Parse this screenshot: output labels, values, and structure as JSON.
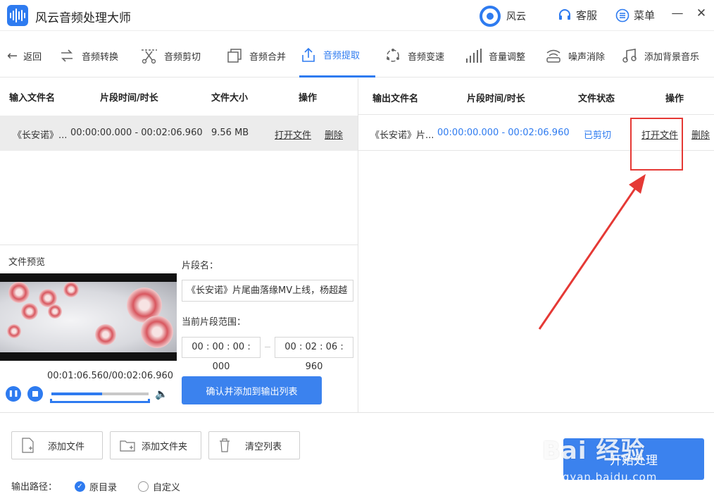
{
  "app": {
    "title": "风云音频处理大师",
    "brand": "风云",
    "service": "客服",
    "menu": "菜单"
  },
  "window": {
    "minimize": "—",
    "close": "✕"
  },
  "toolbar": {
    "back": "返回",
    "items": [
      "音频转换",
      "音频剪切",
      "音频合并",
      "音频提取",
      "音频变速",
      "音量调整",
      "噪声消除",
      "添加背景音乐"
    ],
    "active": "音频提取"
  },
  "input_table": {
    "headers": [
      "输入文件名",
      "片段时间/时长",
      "文件大小",
      "操作"
    ],
    "rows": [
      {
        "name": "《长安诺》...",
        "time": "00:00:00.000 - 00:02:06.960",
        "size": "9.56 MB",
        "open": "打开文件",
        "delete": "删除"
      }
    ]
  },
  "output_table": {
    "headers": [
      "输出文件名",
      "片段时间/时长",
      "文件状态",
      "操作"
    ],
    "rows": [
      {
        "name": "《长安诺》片...",
        "time": "00:00:00.000 - 00:02:06.960",
        "status": "已剪切",
        "open": "打开文件",
        "delete": "删除"
      }
    ]
  },
  "preview": {
    "title": "文件预览",
    "time": "00:01:06.560/00:02:06.960",
    "progress": 0.52
  },
  "segment": {
    "name_label": "片段名：",
    "name_value": "《长安诺》片尾曲落缘MV上线，杨超越",
    "range_label": "当前片段范围：",
    "start": "00 : 00 : 00 : 000",
    "end": "00 : 02 : 06 : 960",
    "confirm": "确认并添加到输出列表"
  },
  "bottom": {
    "add_file": "添加文件",
    "add_folder": "添加文件夹",
    "clear_list": "清空列表",
    "output_path_label": "输出路径：",
    "option_original": "原目录",
    "option_custom": "自定义",
    "start": "开始处理"
  },
  "watermark": {
    "main": "Bai 经验",
    "sub": "jingyan.baidu.com"
  },
  "colors": {
    "accent": "#2e7bf0",
    "annotation": "#e53935"
  }
}
